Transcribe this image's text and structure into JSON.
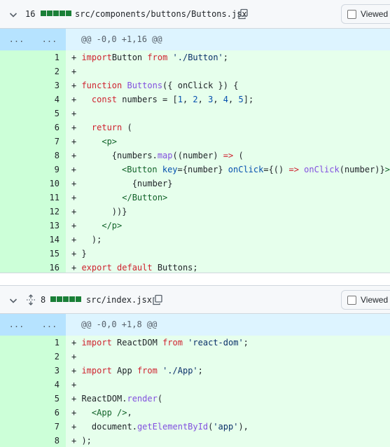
{
  "files": [
    {
      "additions": "16",
      "path": "src/components/buttons/Buttons.jsx",
      "viewed_label": "Viewed",
      "hunk_left": "...",
      "hunk_right": "...",
      "hunk_header": "@@ -0,0 +1,16 @@",
      "lines": [
        {
          "num": "1",
          "code": [
            [
              "k",
              "import"
            ],
            [
              "",
              "Button "
            ],
            [
              "k",
              "from"
            ],
            [
              "s",
              " './Button'"
            ],
            [
              "",
              ";"
            ]
          ]
        },
        {
          "num": "2",
          "code": []
        },
        {
          "num": "3",
          "code": [
            [
              "k",
              "function"
            ],
            [
              "f",
              " Buttons"
            ],
            [
              "",
              "({ onClick }) {"
            ]
          ]
        },
        {
          "num": "4",
          "code": [
            [
              "",
              "  "
            ],
            [
              "k",
              "const"
            ],
            [
              "",
              " numbers = ["
            ],
            [
              "a",
              "1"
            ],
            [
              "",
              ", "
            ],
            [
              "a",
              "2"
            ],
            [
              "",
              ", "
            ],
            [
              "a",
              "3"
            ],
            [
              "",
              ", "
            ],
            [
              "a",
              "4"
            ],
            [
              "",
              ", "
            ],
            [
              "a",
              "5"
            ],
            [
              "",
              "];"
            ]
          ]
        },
        {
          "num": "5",
          "code": []
        },
        {
          "num": "6",
          "code": [
            [
              "",
              "  "
            ],
            [
              "k",
              "return"
            ],
            [
              "",
              " ("
            ]
          ]
        },
        {
          "num": "7",
          "code": [
            [
              "",
              "    "
            ],
            [
              "t",
              "<p>"
            ]
          ]
        },
        {
          "num": "8",
          "code": [
            [
              "",
              "      {numbers."
            ],
            [
              "f",
              "map"
            ],
            [
              "",
              "((number) "
            ],
            [
              "k",
              "=>"
            ],
            [
              "",
              " ("
            ]
          ]
        },
        {
          "num": "9",
          "code": [
            [
              "",
              "        "
            ],
            [
              "t",
              "<Button"
            ],
            [
              "a",
              " key"
            ],
            [
              "",
              "={number}"
            ],
            [
              "a",
              " onClick"
            ],
            [
              "",
              "={() "
            ],
            [
              "k",
              "=>"
            ],
            [
              "f",
              " onClick"
            ],
            [
              "",
              "(number)}"
            ],
            [
              "t",
              ">"
            ]
          ]
        },
        {
          "num": "10",
          "code": [
            [
              "",
              "          {number}"
            ]
          ]
        },
        {
          "num": "11",
          "code": [
            [
              "",
              "        "
            ],
            [
              "t",
              "</Button>"
            ]
          ]
        },
        {
          "num": "12",
          "code": [
            [
              "",
              "      ))}"
            ]
          ]
        },
        {
          "num": "13",
          "code": [
            [
              "",
              "    "
            ],
            [
              "t",
              "</p>"
            ]
          ]
        },
        {
          "num": "14",
          "code": [
            [
              "",
              "  );"
            ]
          ]
        },
        {
          "num": "15",
          "code": [
            [
              "",
              "}"
            ]
          ]
        },
        {
          "num": "16",
          "code": [
            [
              "k",
              "export"
            ],
            [
              "k",
              " default"
            ],
            [
              "",
              " Buttons;"
            ]
          ]
        }
      ]
    },
    {
      "additions": "8",
      "path": "src/index.jsx",
      "viewed_label": "Viewed",
      "hunk_left": "...",
      "hunk_right": "...",
      "hunk_header": "@@ -0,0 +1,8 @@",
      "lines": [
        {
          "num": "1",
          "code": [
            [
              "k",
              "import"
            ],
            [
              "",
              " ReactDOM "
            ],
            [
              "k",
              "from"
            ],
            [
              "s",
              " 'react-dom'"
            ],
            [
              "",
              ";"
            ]
          ]
        },
        {
          "num": "2",
          "code": []
        },
        {
          "num": "3",
          "code": [
            [
              "k",
              "import"
            ],
            [
              "",
              " App "
            ],
            [
              "k",
              "from"
            ],
            [
              "s",
              " './App'"
            ],
            [
              "",
              ";"
            ]
          ]
        },
        {
          "num": "4",
          "code": []
        },
        {
          "num": "5",
          "code": [
            [
              "",
              "ReactDOM."
            ],
            [
              "f",
              "render"
            ],
            [
              "",
              "("
            ]
          ]
        },
        {
          "num": "6",
          "code": [
            [
              "",
              "  "
            ],
            [
              "t",
              "<App />"
            ],
            [
              "",
              ","
            ]
          ]
        },
        {
          "num": "7",
          "code": [
            [
              "",
              "  document."
            ],
            [
              "f",
              "getElementById"
            ],
            [
              "",
              "("
            ],
            [
              "s",
              "'app'"
            ],
            [
              "",
              "),"
            ]
          ]
        },
        {
          "num": "8",
          "code": [
            [
              "",
              ");"
            ]
          ]
        }
      ]
    }
  ],
  "colors": {
    "addition_block": "#1a7f37",
    "hunk_bg": "#ddf4ff",
    "added_line_bg": "#e6ffec"
  },
  "icons": [
    "chevron-down-icon",
    "unfold-icon",
    "copy-icon"
  ]
}
